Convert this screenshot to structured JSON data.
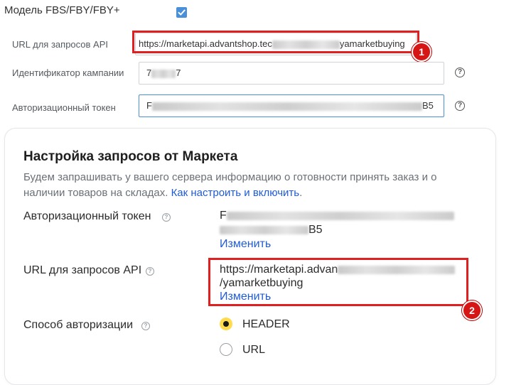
{
  "model": {
    "label": "Модель FBS/FBY/FBY+",
    "checked": true
  },
  "fields": {
    "api_url": {
      "label": "URL для запросов API",
      "value_start": "https://marketapi.advantshop.tec",
      "value_end": "yamarketbuying"
    },
    "campaign_id": {
      "label": "Идентификатор кампании",
      "value_start": "7",
      "value_end": "7"
    },
    "auth_token": {
      "label": "Авторизационный токен",
      "value_start": "F",
      "value_end": "B5"
    }
  },
  "market_settings": {
    "title": "Настройка запросов от Маркета",
    "description": "Будем запрашивать у вашего сервера информацию о готовности принять заказ и о наличии товаров на складах.",
    "how_to_link": "Как настроить и включить",
    "how_to_suffix": ".",
    "token": {
      "label": "Авторизационный токен",
      "line1_start": "F",
      "line2_end": "B5",
      "change_link": "Изменить"
    },
    "api_url": {
      "label": "URL для запросов API",
      "line1_start": "https://marketapi.advan",
      "line2": "/yamarketbuying",
      "change_link": "Изменить"
    },
    "auth_method": {
      "label": "Способ авторизации",
      "options": [
        "HEADER",
        "URL"
      ],
      "selected": "HEADER"
    }
  },
  "annotations": {
    "marker1": "1",
    "marker2": "2"
  },
  "icons": {
    "help": "question-circle-icon",
    "checkbox": "checkbox-checked-icon"
  },
  "colors": {
    "accent": "#4a90d9",
    "link": "#1f5bd6",
    "highlight": "#e02020",
    "radio_selected": "#ffdb4d"
  }
}
